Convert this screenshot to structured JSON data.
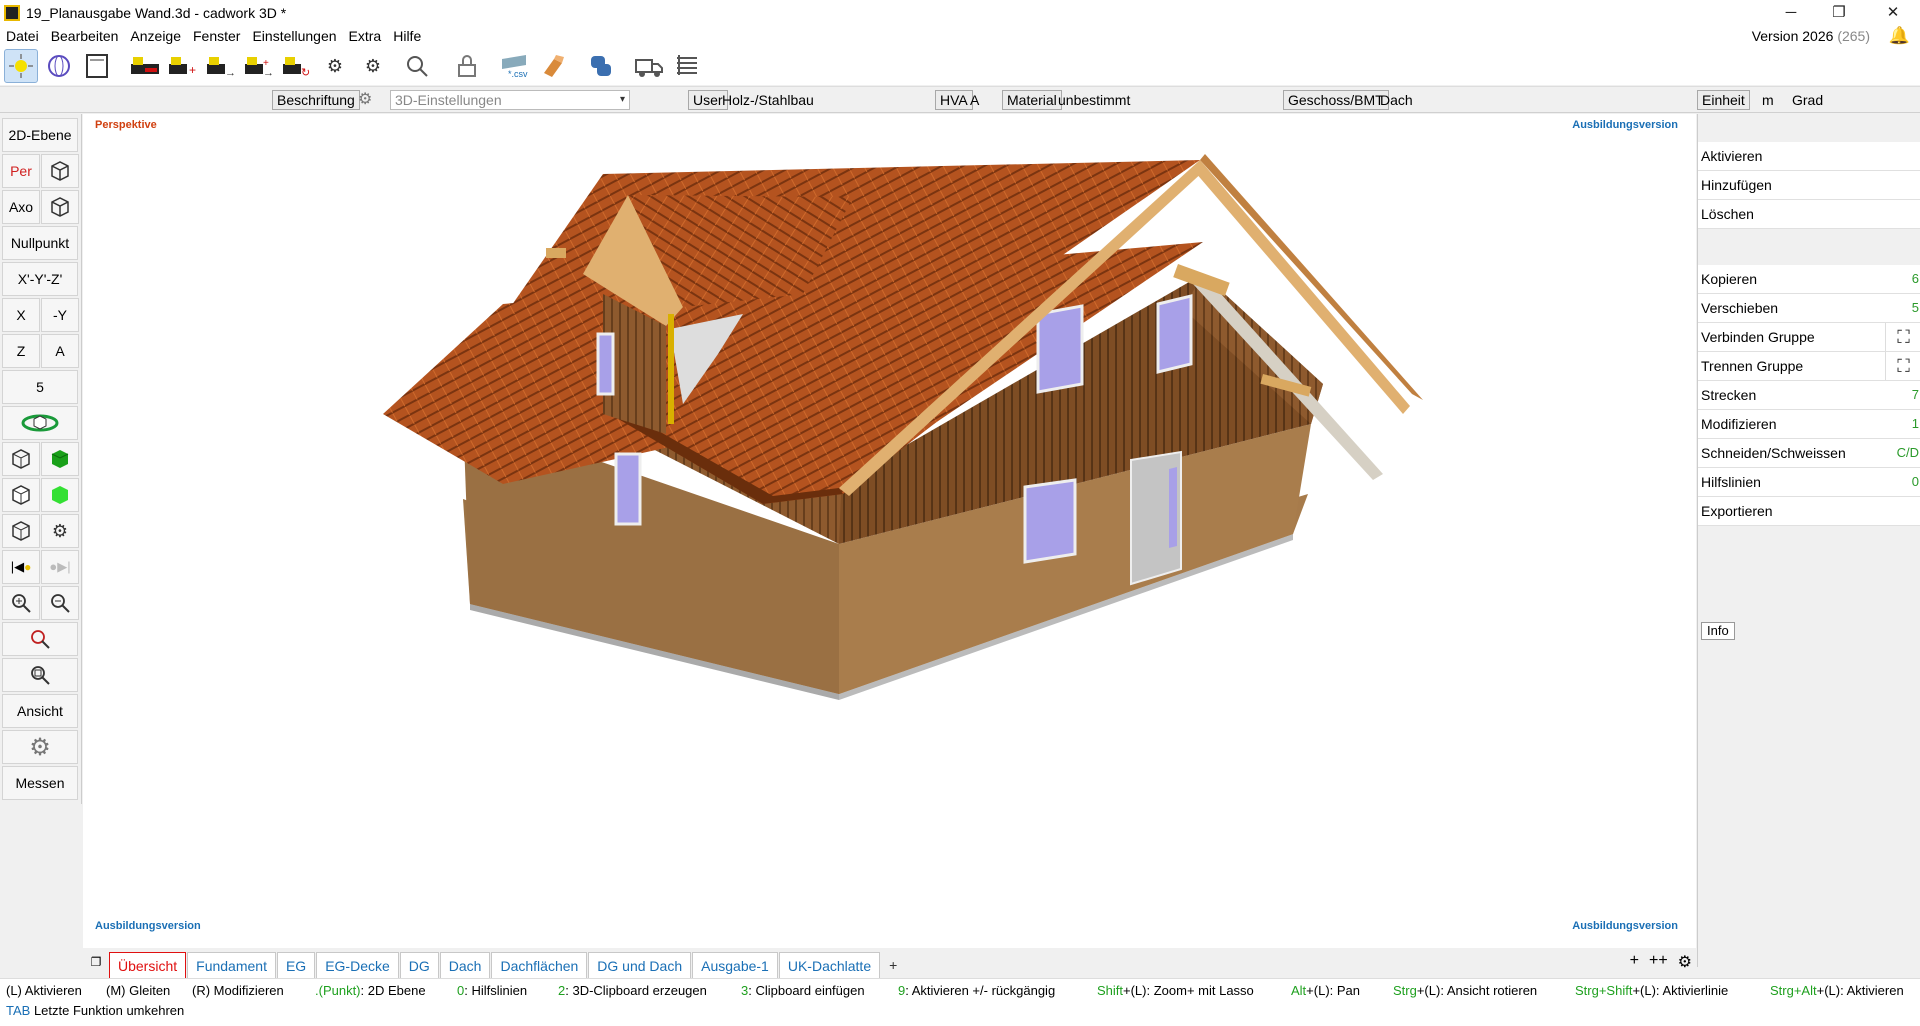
{
  "window": {
    "title": "19_Planausgabe Wand.3d - cadwork 3D *",
    "min": "─",
    "restore": "❐",
    "close": "✕"
  },
  "menu": [
    "Datei",
    "Bearbeiten",
    "Anzeige",
    "Fenster",
    "Einstellungen",
    "Extra",
    "Hilfe"
  ],
  "version": {
    "label": "Version 2026",
    "build": "(265)"
  },
  "toolbar": {
    "icons": [
      "activate-all-icon",
      "sphere-icon",
      "document-icon",
      "machine-icon",
      "machine-add-icon",
      "machine-arrow-icon",
      "machine-add-arrow-icon",
      "machine-cycle-icon",
      "gear-settings-icon",
      "gears-icon",
      "search-icon",
      "lock-icon",
      "csv-export-icon",
      "timber-icon",
      "python-icon",
      "truck-icon",
      "list-icon"
    ]
  },
  "propbar": {
    "beschriftung": "Beschriftung",
    "settings_3d_placeholder": "3D-Einstellungen",
    "user_label": "User",
    "user_value": "Holz-/Stahlbau",
    "hva_label": "HVA",
    "hva_value": "A",
    "material_label": "Material",
    "material_value": "unbestimmt",
    "geschoss_label": "Geschoss/BMT",
    "geschoss_value": "Dach",
    "unit_label": "Einheit",
    "unit_value": "m",
    "angle_value": "Grad"
  },
  "left": {
    "ebene2d": "2D-Ebene",
    "per": "Per",
    "axo": "Axo",
    "nullpunkt": "Nullpunkt",
    "xyz": "X'-Y'-Z'",
    "x": "X",
    "neg_y": "-Y",
    "z": "Z",
    "a": "A",
    "five": "5",
    "ansicht": "Ansicht",
    "messen": "Messen"
  },
  "viewport": {
    "mode": "Perspektive",
    "watermark": "Ausbildungsversion"
  },
  "right": {
    "items": [
      {
        "label": "Aktivieren",
        "key": ""
      },
      {
        "label": "Hinzufügen",
        "key": ""
      },
      {
        "label": "Löschen",
        "key": ""
      },
      {
        "label": "Kopieren",
        "key": "6"
      },
      {
        "label": "Verschieben",
        "key": "5"
      },
      {
        "label": "Verbinden Gruppe",
        "key": ""
      },
      {
        "label": "Trennen Gruppe",
        "key": ""
      },
      {
        "label": "Strecken",
        "key": "7"
      },
      {
        "label": "Modifizieren",
        "key": "1"
      },
      {
        "label": "Schneiden/Schweissen",
        "key": "C/D"
      },
      {
        "label": "Hilfslinien",
        "key": "0"
      },
      {
        "label": "Exportieren",
        "key": ""
      }
    ],
    "info": "Info"
  },
  "tabs": [
    "Übersicht",
    "Fundament",
    "EG",
    "EG-Decke",
    "DG",
    "Dach",
    "Dachflächen",
    "DG und Dach",
    "Ausgabe-1",
    "UK-Dachlatte"
  ],
  "tab_plus": "+",
  "tab_right": {
    "plus": "+",
    "plusplus": "++",
    "gear": "⚙"
  },
  "status": {
    "s1": {
      "a": "(L) Aktivieren"
    },
    "s2": {
      "a": "(M) Gleiten"
    },
    "s3": {
      "a": "(R) Modifizieren"
    },
    "s4": {
      "k": ".(Punkt)",
      "a": ": 2D Ebene"
    },
    "s5": {
      "k": "0",
      "a": ": Hilfslinien"
    },
    "s6": {
      "k": "2",
      "a": ": 3D-Clipboard erzeugen"
    },
    "s7": {
      "k": "3",
      "a": ": Clipboard einfügen"
    },
    "s8": {
      "k": "9",
      "a": ": Aktivieren +/- rückgängig"
    },
    "s9": {
      "k": "Shift",
      "a": "+(L): Zoom+ mit Lasso"
    },
    "s10": {
      "k": "Alt",
      "a": "+(L): Pan"
    },
    "s11": {
      "k": "Strg",
      "a": "+(L): Ansicht rotieren"
    },
    "s12": {
      "k": "Strg+Shift",
      "a": "+(L): Aktivierlinie"
    },
    "s13": {
      "k": "Strg+Alt",
      "a": "+(L): Aktivieren"
    },
    "s14": {
      "k": "TAB",
      "a": " Letzte Funktion umkehren"
    }
  }
}
